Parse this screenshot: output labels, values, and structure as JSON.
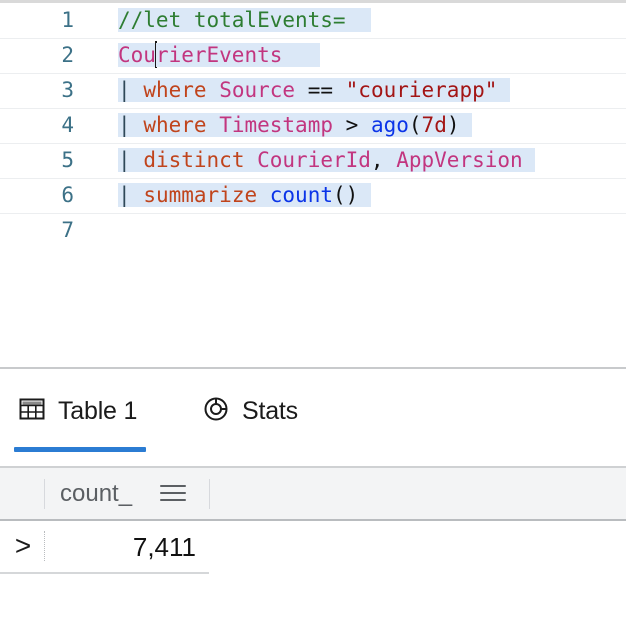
{
  "editor": {
    "language": "kusto",
    "cursor_line": 2,
    "cursor_column": 4,
    "selection_active": true,
    "line_numbers": [
      "1",
      "2",
      "3",
      "4",
      "5",
      "6",
      "7"
    ],
    "lines": [
      {
        "number": "1",
        "text": "//let totalEvents="
      },
      {
        "number": "2",
        "text": "CourierEvents"
      },
      {
        "number": "3",
        "text": "| where Source == \"courierapp\""
      },
      {
        "number": "4",
        "text": "| where Timestamp > ago(7d)"
      },
      {
        "number": "5",
        "text": "| distinct CourierId, AppVersion"
      },
      {
        "number": "6",
        "text": "| summarize count()"
      },
      {
        "number": "7",
        "text": ""
      }
    ],
    "tokens": {
      "comment": "//let totalEvents=",
      "table": "CourierEvents",
      "pipe": "|",
      "kw_where": "where",
      "kw_distinct": "distinct",
      "kw_summarize": "summarize",
      "col_source": "Source",
      "col_timestamp": "Timestamp",
      "col_courierid": "CourierId",
      "col_appversion": "AppVersion",
      "op_eq": "==",
      "op_gt": ">",
      "str_courierapp": "\"courierapp\"",
      "fn_ago": "ago",
      "arg_7d": "7d",
      "fn_count": "count",
      "paren_open": "(",
      "paren_close": ")",
      "comma": ","
    },
    "colors": {
      "comment": "#2e7d32",
      "table": "#c2357f",
      "column": "#c2357f",
      "keyword": "#c0441c",
      "string": "#a31515",
      "function": "#0b34e8",
      "pipe": "#2f4858",
      "line_number": "#3c7187",
      "selection": "#dbe8f7"
    }
  },
  "results": {
    "tabs": [
      {
        "label": "Table 1",
        "icon": "table-icon",
        "selected": true
      },
      {
        "label": "Stats",
        "icon": "donut-chart-icon",
        "selected": false
      }
    ],
    "accent_color": "#2b7cd3",
    "grid": {
      "columns": [
        {
          "name": "count_",
          "menu_icon": "hamburger-menu-icon"
        }
      ],
      "rows": [
        {
          "expand": ">",
          "count_": "7,411"
        }
      ]
    }
  }
}
